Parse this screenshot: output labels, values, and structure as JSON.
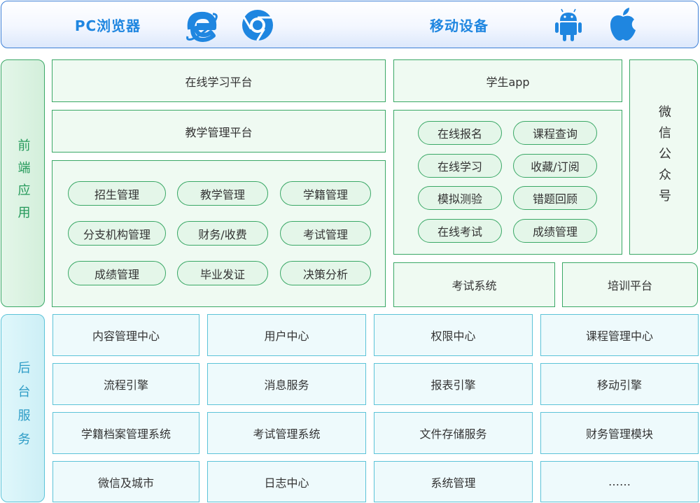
{
  "top": {
    "pc_label": "PC浏览器",
    "mobile_label": "移动设备",
    "icons": [
      "ie-icon",
      "chrome-icon",
      "android-icon",
      "apple-icon"
    ]
  },
  "frontend": {
    "side_label": "前端应用",
    "online_learning": "在线学习平台",
    "teaching_mgmt": "教学管理平台",
    "mgmt_modules": [
      "招生管理",
      "教学管理",
      "学籍管理",
      "分支机构管理",
      "财务/收费",
      "考试管理",
      "成绩管理",
      "毕业发证",
      "决策分析"
    ],
    "student_app": "学生app",
    "app_features": [
      "在线报名",
      "课程查询",
      "在线学习",
      "收藏/订阅",
      "模拟测验",
      "错题回顾",
      "在线考试",
      "成绩管理"
    ],
    "wechat": "微信公众号",
    "exam_system": "考试系统",
    "training": "培训平台"
  },
  "backend": {
    "side_label": "后台服务",
    "services": [
      [
        "内容管理中心",
        "用户中心",
        "权限中心",
        "课程管理中心"
      ],
      [
        "流程引擎",
        "消息服务",
        "报表引擎",
        "移动引擎"
      ],
      [
        "学籍档案管理系统",
        "考试管理系统",
        "文件存储服务",
        "财务管理模块"
      ],
      [
        "微信及城市",
        "日志中心",
        "系统管理",
        "……"
      ]
    ]
  },
  "colors": {
    "header_blue": "#1f86e0",
    "front_green": "#3aa866",
    "back_cyan": "#5cc3d8"
  }
}
